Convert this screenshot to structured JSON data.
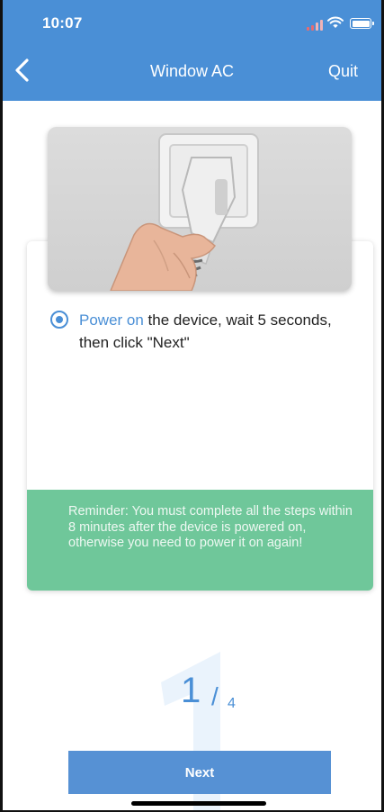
{
  "status_bar": {
    "time": "10:07"
  },
  "nav": {
    "title": "Window AC",
    "quit_label": "Quit"
  },
  "step": {
    "highlight": "Power on",
    "text": " the device, wait 5 seconds, then click \"Next\""
  },
  "reminder": {
    "text": "Reminder: You must complete all the steps within 8 minutes after the device is powered on, otherwise you need  to power it on again!"
  },
  "progress": {
    "current": "1",
    "separator": "/",
    "total": "4"
  },
  "next_button": {
    "label": "Next"
  },
  "colors": {
    "header": "#4a8fd6",
    "accent": "#4a8fd6",
    "reminder_bg": "#6fc79a",
    "next_button": "#5691d4"
  },
  "icons": {
    "back": "chevron-left-icon",
    "signal": "cellular-signal-icon",
    "wifi": "wifi-icon",
    "battery": "battery-icon",
    "radio": "radio-selected-icon"
  }
}
